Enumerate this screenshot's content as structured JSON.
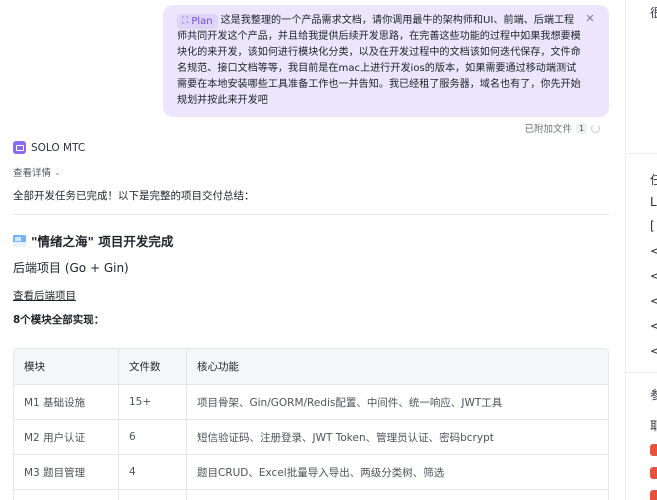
{
  "user_message": {
    "tag": "Plan",
    "text": "这是我整理的一个产品需求文档，请你调用最牛的架构师和UI、前端、后端工程师共同开发这个产品，并且给我提供后续开发思路，在完善这些功能的过程中如果我想要模块化的来开发，该如何进行模块化分类，以及在开发过程中的文档该如何迭代保存，文件命名规范、接口文档等等，我目前是在mac上进行开发ios的版本，如果需要通过移动端测试需要在本地安装哪些工具准备工作也一并告知。我已经租了服务器，域名也有了，你先开始规划并按此来开发吧",
    "attached_label": "已附加文件",
    "attached_count": "1"
  },
  "agent": {
    "name": "SOLO MTC",
    "view_details": "查看详情",
    "summary": "全部开发任务已完成！以下是完整的项目交付总结："
  },
  "report": {
    "title": "\"情绪之海\" 项目开发完成",
    "section_title": "后端项目 (Go + Gin)",
    "link_text": "查看后端项目",
    "modules_line": "8个模块全部实现："
  },
  "table": {
    "headers": [
      "模块",
      "文件数",
      "核心功能"
    ],
    "rows": [
      [
        "M1 基础设施",
        "15+",
        "项目骨架、Gin/GORM/Redis配置、中间件、统一响应、JWT工具"
      ],
      [
        "M2 用户认证",
        "6",
        "短信验证码、注册登录、JWT Token、管理员认证、密码bcrypt"
      ],
      [
        "M3 题目管理",
        "4",
        "题目CRUD、Excel批量导入导出、两级分类树、筛选"
      ]
    ]
  },
  "right_panel": {
    "glyphs": [
      "很",
      "任",
      "L",
      "[",
      "<",
      "<",
      "<",
      "<",
      "<",
      "参",
      "耶"
    ]
  },
  "colors": {
    "bubble_bg": "#ebe6fb",
    "plan_tag": "#6a4fd3",
    "agent_logo": "#8b6cf0"
  }
}
